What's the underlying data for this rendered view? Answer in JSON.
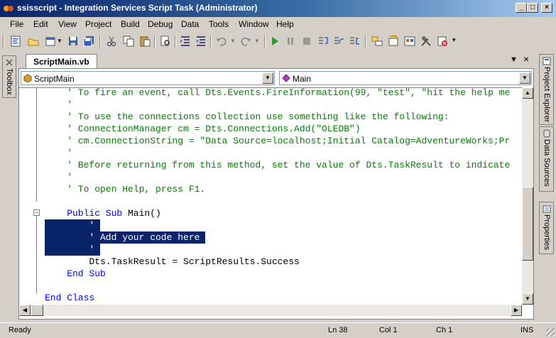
{
  "window": {
    "title": "ssisscript - Integration Services Script Task (Administrator)",
    "buttons": {
      "minimize": "_",
      "maximize": "□",
      "close": "×"
    }
  },
  "menu": [
    "File",
    "Edit",
    "View",
    "Project",
    "Build",
    "Debug",
    "Data",
    "Tools",
    "Window",
    "Help"
  ],
  "toolbar": {
    "icons": [
      "view-code-icon",
      "open-file-icon",
      "add-item-icon",
      "dropdown-icon",
      "save-icon",
      "save-all-icon",
      "cut-icon",
      "copy-icon",
      "paste-icon",
      "find-icon",
      "indent-icon",
      "outdent-icon",
      "undo-icon",
      "dropdown-icon",
      "redo-icon",
      "dropdown-icon",
      "start-icon",
      "pause-icon",
      "stop-icon",
      "step-into-icon",
      "step-over-icon",
      "step-out-icon",
      "solution-explorer-icon",
      "properties-icon",
      "object-browser-icon",
      "toolbox-icon",
      "error-list-icon",
      "overflow-icon"
    ]
  },
  "tabs": {
    "active": "ScriptMain.vb",
    "close": "×",
    "pin": "▼"
  },
  "side": {
    "left": "Toolbox",
    "right_top": "Project Explorer",
    "right_mid": "Data Sources",
    "right_bottom": "Properties"
  },
  "editor": {
    "class_combo": "ScriptMain",
    "method_combo": "Main",
    "lines": [
      {
        "indent": 4,
        "tokens": [
          {
            "c": "cm",
            "t": "' To fire an event, call Dts.Events.FireInformation(99, \"test\", \"hit the help me"
          }
        ]
      },
      {
        "indent": 4,
        "tokens": [
          {
            "c": "cm",
            "t": "'"
          }
        ]
      },
      {
        "indent": 4,
        "tokens": [
          {
            "c": "cm",
            "t": "' To use the connections collection use something like the following:"
          }
        ]
      },
      {
        "indent": 4,
        "tokens": [
          {
            "c": "cm",
            "t": "' ConnectionManager cm = Dts.Connections.Add(\"OLEDB\")"
          }
        ]
      },
      {
        "indent": 4,
        "tokens": [
          {
            "c": "cm",
            "t": "' cm.ConnectionString = \"Data Source=localhost;Initial Catalog=AdventureWorks;Pr"
          }
        ]
      },
      {
        "indent": 4,
        "tokens": [
          {
            "c": "cm",
            "t": "'"
          }
        ]
      },
      {
        "indent": 4,
        "tokens": [
          {
            "c": "cm",
            "t": "' Before returning from this method, set the value of Dts.TaskResult to indicate"
          }
        ]
      },
      {
        "indent": 4,
        "tokens": [
          {
            "c": "cm",
            "t": "'"
          }
        ]
      },
      {
        "indent": 4,
        "tokens": [
          {
            "c": "cm",
            "t": "' To open Help, press F1."
          }
        ]
      },
      {
        "indent": 0,
        "tokens": []
      },
      {
        "indent": 4,
        "tokens": [
          {
            "c": "kw",
            "t": "Public Sub "
          },
          {
            "c": "nm",
            "t": "Main()"
          }
        ]
      },
      {
        "indent": 8,
        "tokens": [
          {
            "c": "cm",
            "t": "'"
          }
        ]
      },
      {
        "indent": 8,
        "tokens": [
          {
            "c": "cm",
            "t": "' Add your code here"
          }
        ]
      },
      {
        "indent": 8,
        "tokens": [
          {
            "c": "cm",
            "t": "'"
          }
        ]
      },
      {
        "indent": 8,
        "tokens": [
          {
            "c": "nm",
            "t": "Dts.TaskResult = ScriptResults.Success"
          }
        ]
      },
      {
        "indent": 4,
        "tokens": [
          {
            "c": "kw",
            "t": "End Sub"
          }
        ]
      },
      {
        "indent": 0,
        "tokens": []
      },
      {
        "indent": 0,
        "tokens": [
          {
            "c": "kw",
            "t": "End Class"
          }
        ]
      }
    ],
    "selected_lines": [
      11,
      12,
      13
    ]
  },
  "status": {
    "ready": "Ready",
    "ln": "Ln 38",
    "col": "Col 1",
    "ch": "Ch 1",
    "mode": "INS"
  }
}
